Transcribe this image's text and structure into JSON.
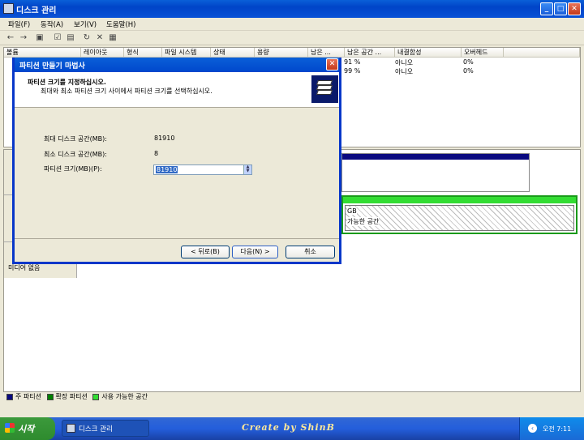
{
  "window": {
    "title": "디스크 관리"
  },
  "menu": [
    "파일(F)",
    "동작(A)",
    "보기(V)",
    "도움말(H)"
  ],
  "columns": [
    "볼륨",
    "레이아웃",
    "형식",
    "파일 시스템",
    "상태",
    "용량",
    "남은 ...",
    "남은 공간 ...",
    "내결함성",
    "오버헤드"
  ],
  "rows": [
    {
      "free_pct": "91 %",
      "fault": "아니오",
      "overhead": "0%"
    },
    {
      "free_pct": "99 %",
      "fault": "아니오",
      "overhead": "0%"
    }
  ],
  "graph": {
    "gb_text": "GB",
    "avail_text": "가능한 공간",
    "no_media": "미디어 없음"
  },
  "legend": [
    {
      "label": "주 파티션",
      "color": "#0A0A80"
    },
    {
      "label": "확장 파티션",
      "color": "#008000"
    },
    {
      "label": "사용 가능한 공간",
      "color": "#33DD33"
    }
  ],
  "dialog": {
    "title": "파티션 만들기 마법사",
    "heading": "파티션 크기를 지정하십시오.",
    "subheading": "최대와 최소 파티션 크기 사이에서 파티션 크기를 선택하십시오.",
    "max_label": "최대 디스크 공간(MB):",
    "max_value": "81910",
    "min_label": "최소 디스크 공간(MB):",
    "min_value": "8",
    "size_label": "파티션 크기(MB)(P):",
    "size_value": "81910",
    "back_button": "< 뒤로(B)",
    "next_button": "다음(N) >",
    "cancel_button": "취소"
  },
  "taskbar": {
    "start": "시작",
    "task": "디스크 관리",
    "brand": "Create by ShinB",
    "clock": "오전 7:11"
  }
}
